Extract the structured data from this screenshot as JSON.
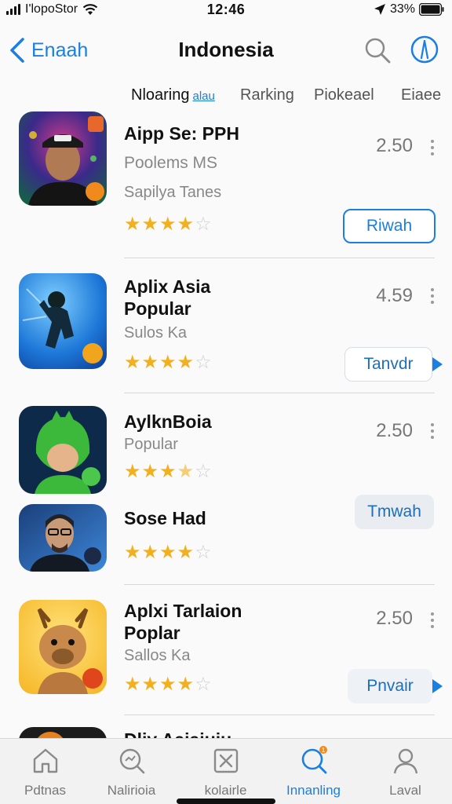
{
  "status_bar": {
    "carrier": "I'lopoStor",
    "time": "12:46",
    "battery": "33%"
  },
  "nav": {
    "back_label": "Enaah",
    "title": "Indonesia",
    "icons": [
      "chevron-left-icon",
      "search-icon",
      "compass-icon"
    ]
  },
  "segments": [
    {
      "label": "Nloaring",
      "accent": "alau"
    },
    {
      "label": "Rarking"
    },
    {
      "label": "Piokeael"
    },
    {
      "label": "Eiaee"
    }
  ],
  "apps": [
    {
      "name": "Aipp Se: PPH",
      "subtitle": "Poolems MS",
      "category": "Sapilya Tanes",
      "price": "2.50",
      "rating": 4,
      "button_label": "Riwah"
    },
    {
      "name": "Aplix Asia\nPopular",
      "subtitle": "Sulos Ka",
      "price": "4.59",
      "rating": 4,
      "button_label": "Tanvdr"
    },
    {
      "name": "AylknBoia",
      "subtitle": "Popular",
      "price": "2.50",
      "rating": 3.5
    },
    {
      "name": "Sose Had",
      "rating": 4,
      "button_label": "Tmwah"
    },
    {
      "name": "Aplxi Tarlaion\nPoplar",
      "subtitle": "Sallos Ka",
      "price": "2.50",
      "rating": 4,
      "button_label": "Pnvair"
    },
    {
      "name": "Dliy Aaiaiuiu"
    }
  ],
  "tab_bar": [
    {
      "label": "Pdtnas",
      "icon": "home-icon"
    },
    {
      "label": "Nalirioia",
      "icon": "magnifier-chart-icon"
    },
    {
      "label": "kolairle",
      "icon": "close-box-icon"
    },
    {
      "label": "Innanling",
      "icon": "search-badge-icon",
      "badge": "1"
    },
    {
      "label": "Laval",
      "icon": "person-icon"
    }
  ],
  "colors": {
    "accent": "#1a7fe0",
    "star": "#f2b01e",
    "text_secondary": "#888888",
    "divider": "#d9d9d9"
  }
}
